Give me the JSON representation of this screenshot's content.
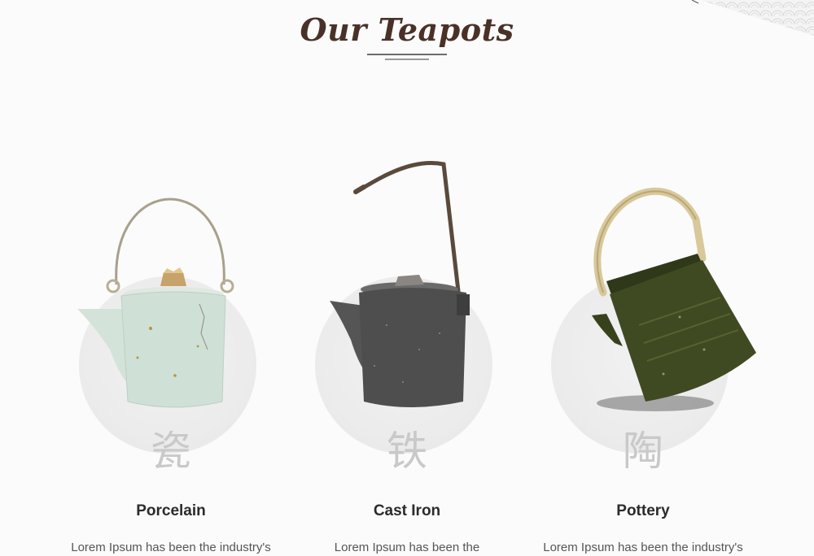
{
  "section": {
    "title": "Our Teapots"
  },
  "cards": [
    {
      "glyph": "瓷",
      "name": "Porcelain",
      "description": "Lorem Ipsum has been the industry's"
    },
    {
      "glyph": "铁",
      "name": "Cast Iron",
      "description": "Lorem Ipsum has been the"
    },
    {
      "glyph": "陶",
      "name": "Pottery",
      "description": "Lorem Ipsum has been the industry's"
    }
  ],
  "colors": {
    "title": "#4a3128",
    "circle": "#ececec",
    "glyph": "#c9c9c9",
    "porcelain_body": "#cfe0d6",
    "cast_iron_body": "#4e4e4f",
    "pottery_body": "#3f4a22",
    "bamboo_handle": "#d8c89a"
  },
  "icons": [
    "wave-pattern-decoration",
    "porcelain-teapot-image",
    "cast-iron-teapot-image",
    "pottery-teapot-image"
  ]
}
